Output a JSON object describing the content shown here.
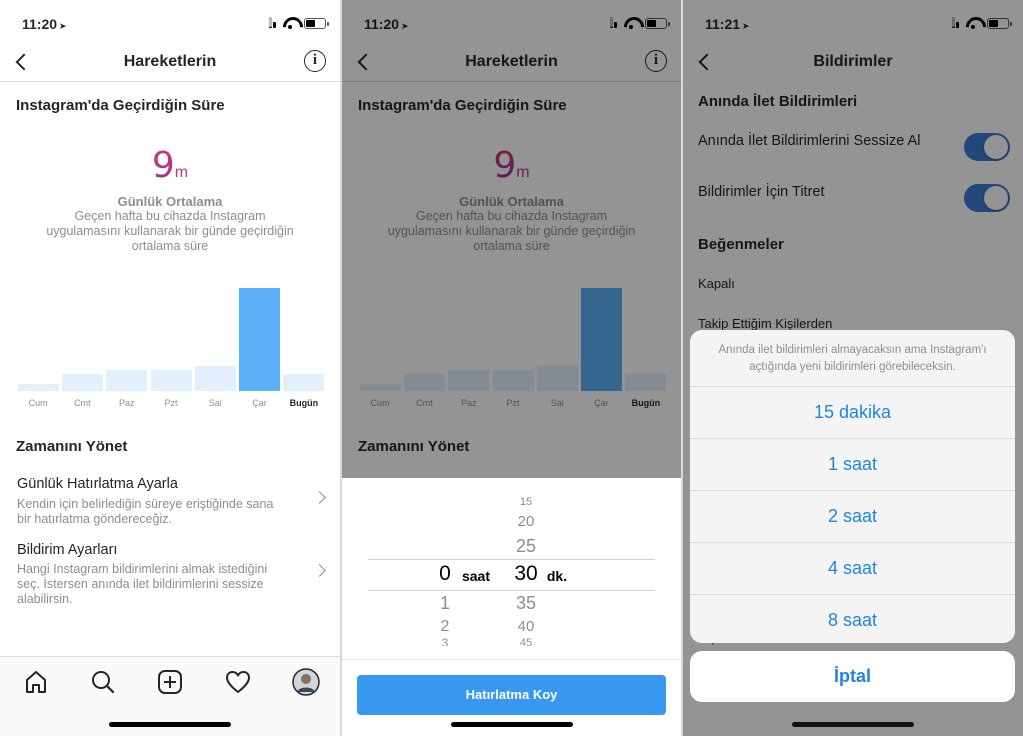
{
  "screen1": {
    "status_time": "11:20",
    "nav_title": "Hareketlerin",
    "section_title": "Instagram'da Geçirdiğin Süre",
    "avg_value": "9",
    "avg_unit": "m",
    "avg_label": "Günlük Ortalama",
    "avg_desc": "Geçen hafta bu cihazda Instagram uygulamasını kullanarak bir günde geçirdiğin ortalama süre",
    "manage_title": "Zamanını Yönet",
    "row1_title": "Günlük Hatırlatma Ayarla",
    "row1_sub": "Kendin için belirlediğin süreye eriştiğinde sana bir hatırlatma göndereceğiz.",
    "row2_title": "Bildirim Ayarları",
    "row2_sub": "Hangi Instagram bildirimlerini almak istediğini seç. İstersen anında ilet bildirimlerini sessize alabilirsin.",
    "tabs": [
      "home-icon",
      "search-icon",
      "add-post-icon",
      "heart-icon",
      "profile-avatar"
    ]
  },
  "chart_data": {
    "type": "bar",
    "categories": [
      "Cum",
      "Cmt",
      "Paz",
      "Pzt",
      "Sal",
      "Çar",
      "Bugün"
    ],
    "values": [
      0.7,
      1.6,
      2.0,
      2.0,
      2.4,
      9.9,
      1.6
    ],
    "highlight": "Çar",
    "title": "",
    "xlabel": "",
    "ylabel": "",
    "ylim": [
      0,
      10
    ],
    "colors": {
      "bar": "#e2f0fd",
      "highlight": "#5cb0f8"
    }
  },
  "screen2": {
    "status_time": "11:20",
    "nav_title": "Hareketlerin",
    "section_title": "Instagram'da Geçirdiğin Süre",
    "avg_value": "9",
    "avg_unit": "m",
    "avg_label": "Günlük Ortalama",
    "avg_desc": "Geçen hafta bu cihazda Instagram uygulamasını kullanarak bir günde geçirdiğin ortalama süre",
    "manage_title": "Zamanını Yönet",
    "picker": {
      "hours_above": [],
      "hour_selected": "0",
      "hours_below": [
        "1",
        "2",
        "3"
      ],
      "hour_unit": "saat",
      "minutes_above": [
        "15",
        "20",
        "25"
      ],
      "minute_selected": "30",
      "minutes_below": [
        "35",
        "40",
        "45"
      ],
      "minute_unit": "dk."
    },
    "button_label": "Hatırlatma Koy"
  },
  "screen3": {
    "status_time": "11:21",
    "nav_title": "Bildirimler",
    "head1": "Anında İlet Bildirimleri",
    "toggle1_label": "Anında İlet Bildirimlerini Sessize Al",
    "toggle2_label": "Bildirimler İçin Titret",
    "head2": "Beğenmeler",
    "opt_off": "Kapalı",
    "opt_following": "Takip Ettiğim Kişilerden",
    "opt_off_bottom": "Kapalı",
    "sheet_message": "Anında ilet bildirimleri almayacaksın ama Instagram'ı açtığında yeni bildirimleri görebileceksin.",
    "options": [
      "15 dakika",
      "1 saat",
      "2 saat",
      "4 saat",
      "8 saat"
    ],
    "cancel": "İptal"
  },
  "colors": {
    "accent": "#3897f0",
    "sheet_text": "#1f86e0",
    "toggle_on": "#3a7bd5"
  }
}
